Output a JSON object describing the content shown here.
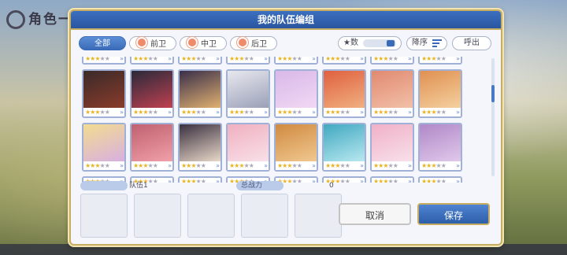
{
  "background": {
    "title": "角色一览"
  },
  "dialog": {
    "title": "我的队伍编组",
    "tabs": [
      {
        "label": "全部",
        "active": true
      },
      {
        "label": "前卫",
        "active": false
      },
      {
        "label": "中卫",
        "active": false
      },
      {
        "label": "后卫",
        "active": false
      }
    ],
    "star_toggle_label": "★数",
    "sort_label": "降序",
    "call_label": "呼出",
    "team_label": "",
    "team_name": "队伍1",
    "power_label": "总战力",
    "power_value": "0",
    "cancel_label": "取消",
    "save_label": "保存"
  },
  "characters_row1": [
    {
      "colors": [
        "#3a2a2a",
        "#8a3b2a"
      ],
      "stars": 3
    },
    {
      "colors": [
        "#2a2a3a",
        "#c04050"
      ],
      "stars": 3
    },
    {
      "colors": [
        "#3a2f4a",
        "#e0b070"
      ],
      "stars": 3
    },
    {
      "colors": [
        "#e8e8ee",
        "#9aa0b8"
      ],
      "stars": 3
    },
    {
      "colors": [
        "#d8b8e8",
        "#f2d8f4"
      ],
      "stars": 3
    },
    {
      "colors": [
        "#e06040",
        "#f0b080"
      ],
      "stars": 3
    },
    {
      "colors": [
        "#e08a70",
        "#f2c0a8"
      ],
      "stars": 3
    },
    {
      "colors": [
        "#e09050",
        "#f4d0a0"
      ],
      "stars": 3
    }
  ],
  "characters_row2": [
    {
      "colors": [
        "#f2dc90",
        "#d8b0e0"
      ],
      "stars": 3
    },
    {
      "colors": [
        "#c06070",
        "#f0a0a8"
      ],
      "stars": 3
    },
    {
      "colors": [
        "#3a3040",
        "#e8d8c8"
      ],
      "stars": 3
    },
    {
      "colors": [
        "#f0b0c0",
        "#f8e0e8"
      ],
      "stars": 3
    },
    {
      "colors": [
        "#d08a40",
        "#f0c890"
      ],
      "stars": 3
    },
    {
      "colors": [
        "#40a8c0",
        "#b8e8f0"
      ],
      "stars": 3
    },
    {
      "colors": [
        "#f0b0c8",
        "#f8e0ea"
      ],
      "stars": 3
    },
    {
      "colors": [
        "#b088c8",
        "#e0c8ea"
      ],
      "stars": 3
    }
  ]
}
